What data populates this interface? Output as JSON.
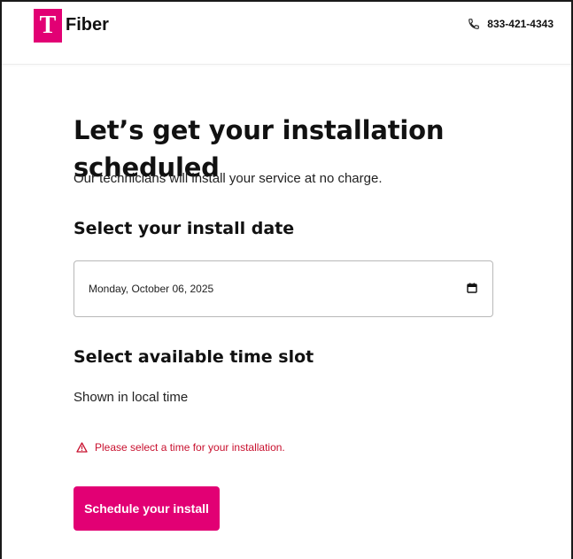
{
  "header": {
    "logo_glyph": "T",
    "brand_name": "Fiber",
    "phone_number": "833-421-4343",
    "phone_icon": "phone-icon"
  },
  "main": {
    "title": "Let’s get your installation scheduled",
    "subtitle": "Our technicians will install your service at no charge.",
    "date_section": {
      "heading": "Select your install date",
      "selected_date": "Monday, October 06, 2025",
      "calendar_icon": "calendar-icon"
    },
    "time_section": {
      "heading": "Select available time slot",
      "note": "Shown in local time",
      "error_icon": "warning-icon",
      "error_message": "Please select a time for your installation."
    },
    "cta_label": "Schedule your install"
  },
  "colors": {
    "brand_magenta": "#e20074",
    "error_red": "#c8102e",
    "text": "#111111"
  }
}
